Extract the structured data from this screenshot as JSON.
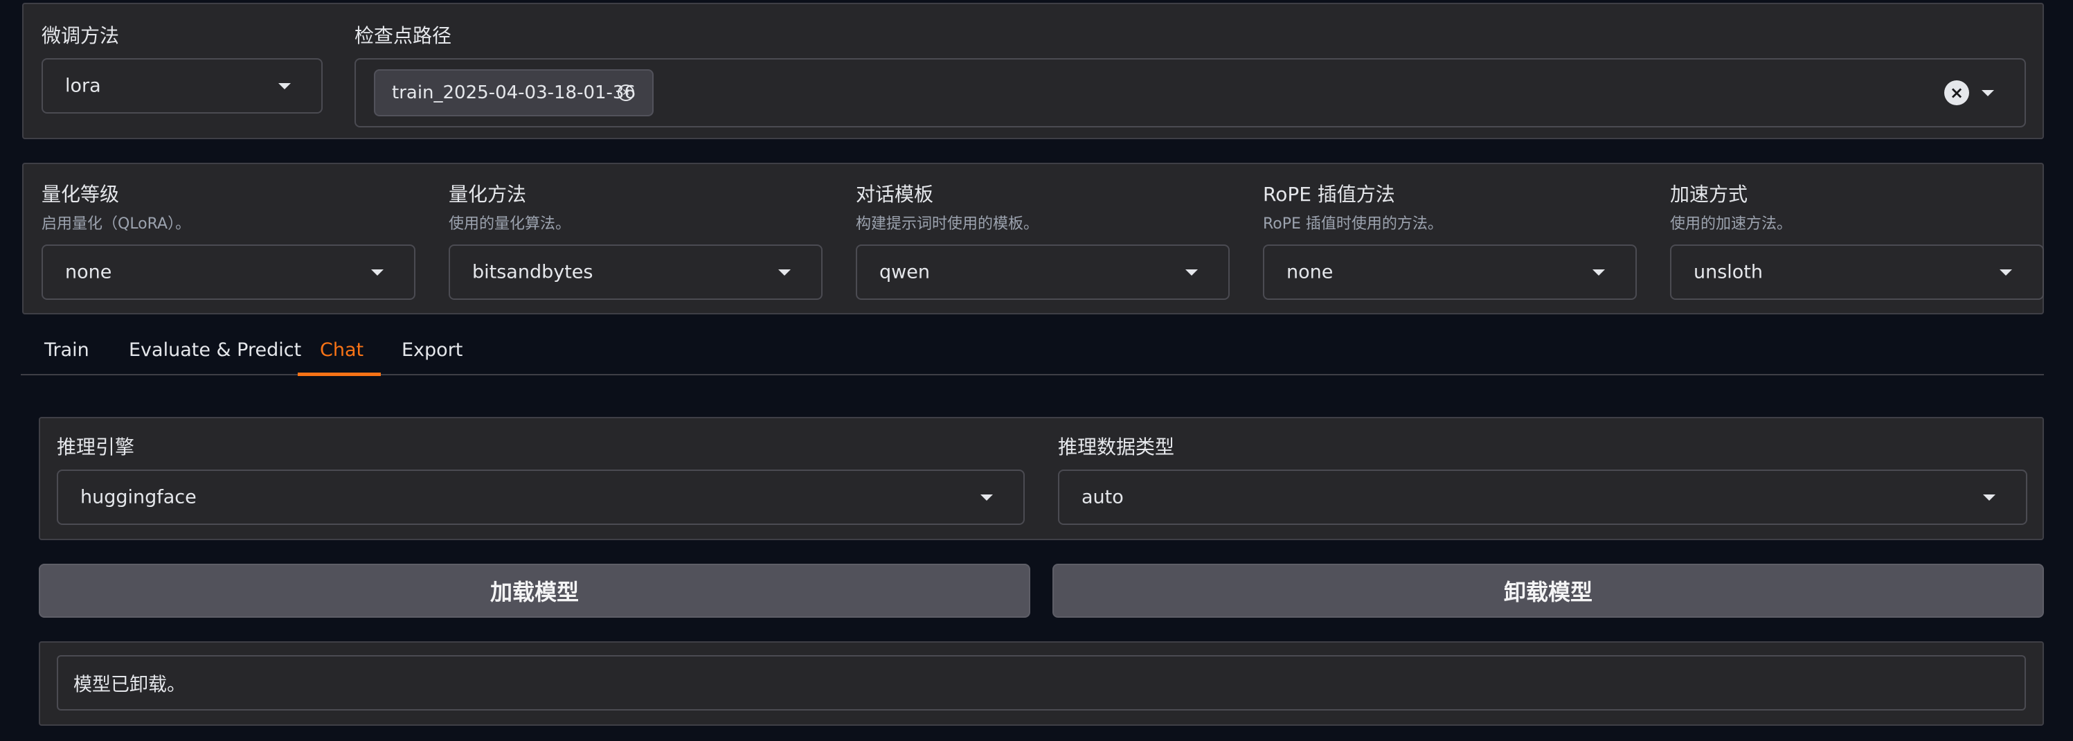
{
  "top": {
    "finetune_method": {
      "label": "微调方法",
      "value": "lora"
    },
    "checkpoint_path": {
      "label": "检查点路径",
      "chips": [
        "train_2025-04-03-18-01-36"
      ]
    }
  },
  "settings": {
    "quantization_bit": {
      "label": "量化等级",
      "hint": "启用量化（QLoRA）。",
      "value": "none"
    },
    "quantization_method": {
      "label": "量化方法",
      "hint": "使用的量化算法。",
      "value": "bitsandbytes"
    },
    "template": {
      "label": "对话模板",
      "hint": "构建提示词时使用的模板。",
      "value": "qwen"
    },
    "rope_scaling": {
      "label": "RoPE 插值方法",
      "hint": "RoPE 插值时使用的方法。",
      "value": "none"
    },
    "booster": {
      "label": "加速方式",
      "hint": "使用的加速方法。",
      "value": "unsloth"
    }
  },
  "tabs": [
    {
      "label": "Train",
      "active": false
    },
    {
      "label": "Evaluate & Predict",
      "active": false
    },
    {
      "label": "Chat",
      "active": true
    },
    {
      "label": "Export",
      "active": false
    }
  ],
  "chat": {
    "infer_backend": {
      "label": "推理引擎",
      "value": "huggingface"
    },
    "infer_dtype": {
      "label": "推理数据类型",
      "value": "auto"
    },
    "load_button": "加载模型",
    "unload_button": "卸载模型",
    "info_box": "模型已卸载。"
  },
  "colors": {
    "accent": "#f97316",
    "background": "#0b0f19",
    "panel": "#27272a",
    "button": "#52525b"
  }
}
